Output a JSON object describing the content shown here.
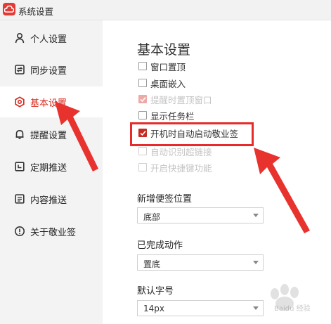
{
  "window": {
    "title": "系统设置",
    "logo_icon": "cloud-logo-icon",
    "brand_color": "#e33b36"
  },
  "sidebar": {
    "items": [
      {
        "label": "个人设置",
        "icon": "person-icon"
      },
      {
        "label": "同步设置",
        "icon": "sync-icon"
      },
      {
        "label": "基本设置",
        "icon": "settings-icon",
        "active": true
      },
      {
        "label": "提醒设置",
        "icon": "bell-icon"
      },
      {
        "label": "定期推送",
        "icon": "calendar-icon"
      },
      {
        "label": "内容推送",
        "icon": "document-icon"
      },
      {
        "label": "关于敬业签",
        "icon": "info-icon"
      }
    ],
    "active_color": "#d9291c"
  },
  "main": {
    "section_title": "基本设置",
    "checkboxes": [
      {
        "label": "窗口置顶",
        "checked": false,
        "disabled": false
      },
      {
        "label": "桌面嵌入",
        "checked": false,
        "disabled": false
      },
      {
        "label": "提醒时置顶窗口",
        "checked": true,
        "disabled": true
      },
      {
        "label": "显示任务栏",
        "checked": false,
        "disabled": false
      },
      {
        "label": "开机时自动启动敬业签",
        "checked": true,
        "disabled": false
      },
      {
        "label": "自动识别超链接",
        "checked": false,
        "disabled": true
      },
      {
        "label": "开启快捷键功能",
        "checked": false,
        "disabled": true
      }
    ],
    "new_note_position": {
      "label": "新增便签位置",
      "value": "底部"
    },
    "completed_action": {
      "label": "已完成动作",
      "value": "置底"
    },
    "default_font_size": {
      "label": "默认字号",
      "value": "14px"
    }
  },
  "annotation": {
    "highlight_color": "#e52b2b"
  },
  "watermark": {
    "text": "Baidu 经验"
  }
}
